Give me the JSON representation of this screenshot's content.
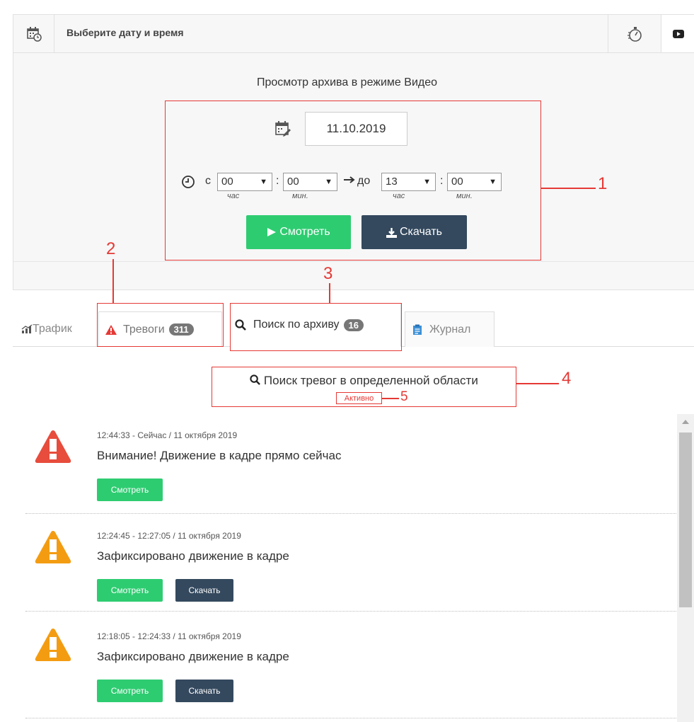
{
  "header": {
    "title": "Выберите дату и время",
    "calendar_icon": "calendar-clock-icon",
    "timer_icon": "stopwatch-icon",
    "video_icon": "video-icon"
  },
  "archive": {
    "title": "Просмотр архива в режиме Видео",
    "date": "11.10.2019",
    "from_label": "с",
    "to_label": "до",
    "from_hour": "00",
    "from_min": "00",
    "to_hour": "13",
    "to_min": "00",
    "hour_sub": "час",
    "min_sub": "мин.",
    "colon": ":",
    "watch_label": "Смотреть",
    "download_label": "Скачать"
  },
  "tabs": [
    {
      "label": "Трафик"
    },
    {
      "label": "Тревоги",
      "badge": "311"
    },
    {
      "label": "Поиск по архиву",
      "badge": "16"
    },
    {
      "label": "Журнал"
    }
  ],
  "search": {
    "title": "Поиск тревог в определенной области",
    "status": "Активно"
  },
  "alarms": [
    {
      "time": "12:44:33 - Сейчас / 11 октября 2019",
      "message": "Внимание! Движение в кадре прямо сейчас",
      "level": "danger",
      "color": "#e74c3c",
      "buttons": [
        "Смотреть"
      ]
    },
    {
      "time": "12:24:45 - 12:27:05 / 11 октября 2019",
      "message": "Зафиксировано движение в кадре",
      "level": "warning",
      "color": "#f39c12",
      "buttons": [
        "Смотреть",
        "Скачать"
      ]
    },
    {
      "time": "12:18:05 - 12:24:33 / 11 октября 2019",
      "message": "Зафиксировано движение в кадре",
      "level": "warning",
      "color": "#f39c12",
      "buttons": [
        "Смотреть",
        "Скачать"
      ]
    }
  ],
  "annotations": [
    "1",
    "2",
    "3",
    "4",
    "5"
  ],
  "colors": {
    "accent_red": "#e53935",
    "green": "#2ecc71",
    "dark": "#34495e"
  }
}
